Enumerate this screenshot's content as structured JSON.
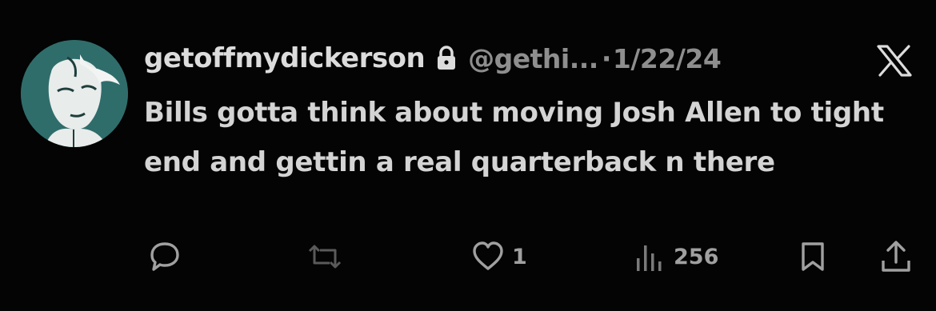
{
  "tweet": {
    "display_name": "getoffmydickerson",
    "handle": "@gethi...",
    "separator": "·",
    "date": "1/22/24",
    "text": "Bills gotta think about moving Josh Allen to tight end and gettin a real quarterback n there",
    "protected_icon": "lock-icon",
    "platform_icon": "x-logo-icon"
  },
  "actions": {
    "reply": {
      "icon": "reply-icon",
      "count": ""
    },
    "retweet": {
      "icon": "retweet-icon",
      "count": ""
    },
    "like": {
      "icon": "heart-icon",
      "count": "1"
    },
    "views": {
      "icon": "views-icon",
      "count": "256"
    },
    "bookmark": {
      "icon": "bookmark-icon"
    },
    "share": {
      "icon": "share-icon"
    }
  },
  "colors": {
    "background": "#040404",
    "name_text": "#dcdcdc",
    "secondary_text": "#8e8e8e",
    "avatar_bg": "#2f6d6b"
  }
}
